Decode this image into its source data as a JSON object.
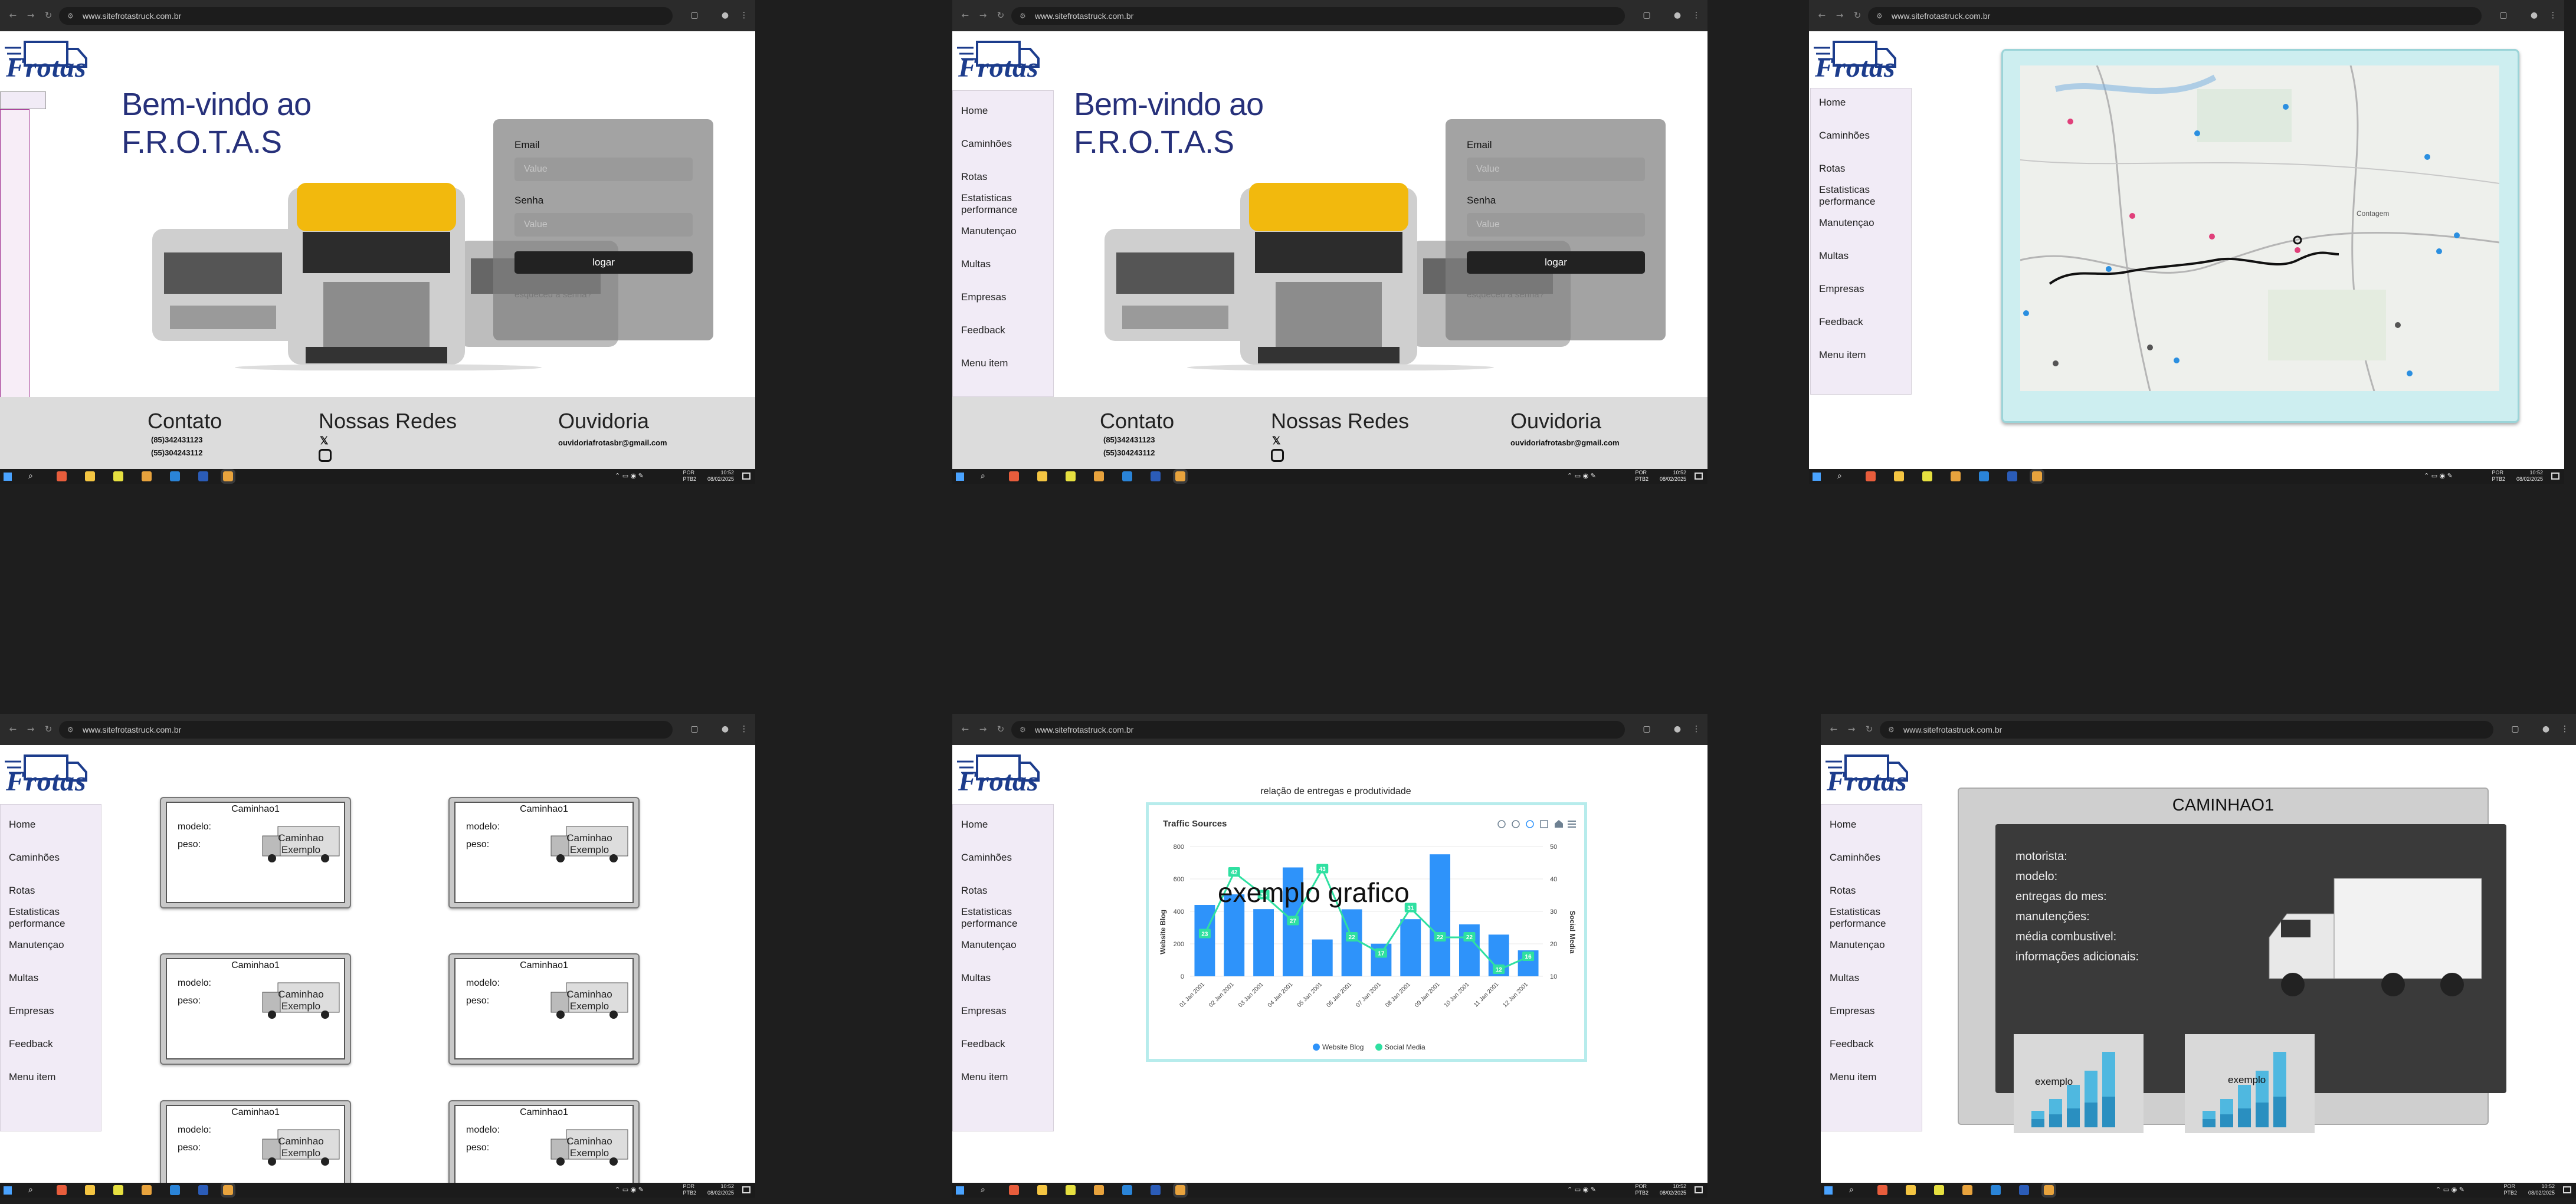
{
  "browser": {
    "url": "www.sitefrotastruck.com.br"
  },
  "taskbar": {
    "lang_line1": "POR",
    "lang_line2": "PTB2",
    "time": "10:52",
    "date": "08/02/2025"
  },
  "logo": {
    "text": "Frotas"
  },
  "nav": {
    "items": [
      "Home",
      "Caminhões",
      "Rotas",
      "Estatisticas performance",
      "Manutençao",
      "Multas",
      "Empresas",
      "Feedback",
      "Menu item"
    ]
  },
  "home": {
    "hero_line1": "Bem-vindo ao",
    "hero_line2": "F.R.O.T.A.S",
    "email_label": "Email",
    "email_placeholder": "Value",
    "senha_label": "Senha",
    "senha_placeholder": "Value",
    "login_button": "logar",
    "forgot_link": "esqueceu a senha?"
  },
  "footer": {
    "contato_title": "Contato",
    "phone1": "(85)342431123",
    "phone2": "(55)304243112",
    "redes_title": "Nossas Redes",
    "ouvidoria_title": "Ouvidoria",
    "ouvidoria_email": "ouvidoriafrotasbr@gmail.com"
  },
  "trucks_page": {
    "cards": [
      {
        "title": "Caminhao1",
        "modelo": "modelo:",
        "peso": "peso:",
        "example": "Caminhao Exemplo"
      },
      {
        "title": "Caminhao1",
        "modelo": "modelo:",
        "peso": "peso:",
        "example": "Caminhao Exemplo"
      },
      {
        "title": "Caminhao1",
        "modelo": "modelo:",
        "peso": "peso:",
        "example": "Caminhao Exemplo"
      },
      {
        "title": "Caminhao1",
        "modelo": "modelo:",
        "peso": "peso:",
        "example": "Caminhao Exemplo"
      },
      {
        "title": "Caminhao1",
        "modelo": "modelo:",
        "peso": "peso:",
        "example": "Caminhao Exemplo"
      },
      {
        "title": "Caminhao1",
        "modelo": "modelo:",
        "peso": "peso:",
        "example": "Caminhao Exemplo"
      }
    ]
  },
  "stats_page": {
    "heading": "relação de entregas e produtividade",
    "overlay": "exemplo grafico"
  },
  "detail_page": {
    "title": "CAMINHAO1",
    "fields": [
      "motorista:",
      "modelo:",
      "entregas do mes:",
      "manutenções:",
      "média combustivel:",
      "informações adicionais:"
    ],
    "chart_label": "exemplo"
  },
  "map_page": {
    "place_label": "Contagem"
  },
  "chart_data": {
    "type": "bar",
    "title": "Traffic Sources",
    "categories": [
      "01 Jan 2001",
      "02 Jan 2001",
      "03 Jan 2001",
      "04 Jan 2001",
      "05 Jan 2001",
      "06 Jan 2001",
      "07 Jan 2001",
      "08 Jan 2001",
      "09 Jan 2001",
      "10 Jan 2001",
      "11 Jan 2001",
      "12 Jan 2001"
    ],
    "series": [
      {
        "name": "Website Blog",
        "values": [
          440,
          505,
          414,
          671,
          227,
          413,
          201,
          352,
          752,
          320,
          257,
          160
        ]
      },
      {
        "name": "Social Media",
        "values": [
          23,
          42,
          35,
          27,
          43,
          22,
          17,
          31,
          22,
          22,
          12,
          16
        ]
      }
    ],
    "ylabel": "Website Blog",
    "y2label": "Social Media",
    "ylim": [
      0,
      800
    ],
    "y2lim": [
      10,
      50
    ],
    "yticks": [
      "800",
      "600",
      "400",
      "200",
      "0"
    ],
    "y2ticks": [
      "50",
      "40",
      "30",
      "20",
      "10"
    ],
    "colors": {
      "bar": "#2e93fa",
      "line": "#2fe0a1"
    },
    "legend_position": "bottom"
  }
}
